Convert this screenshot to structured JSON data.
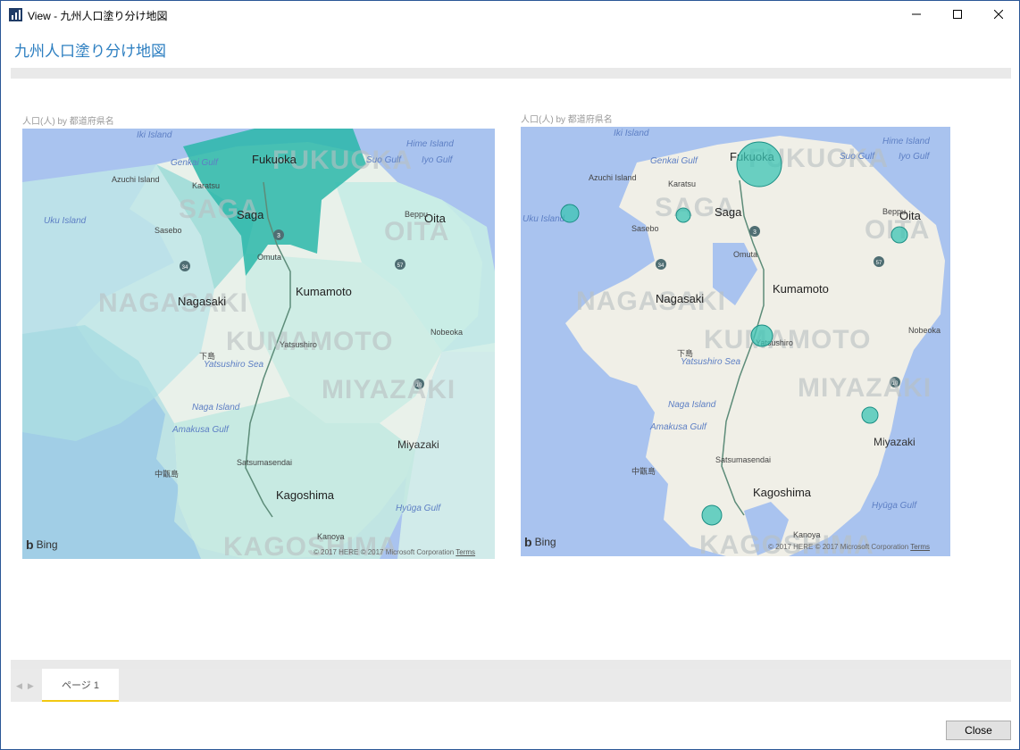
{
  "window": {
    "title": "View - 九州人口塗り分け地図",
    "minimize_icon": "minimize-icon",
    "maximize_icon": "maximize-icon",
    "close_icon": "close-icon"
  },
  "report": {
    "title": "九州人口塗り分け地図"
  },
  "visuals": [
    {
      "title": "人口(人) by 都道府県名",
      "type": "filled-map",
      "attribution": "© 2017 HERE © 2017 Microsoft Corporation",
      "terms_label": "Terms",
      "logo_text": "Bing"
    },
    {
      "title": "人口(人) by 都道府県名",
      "type": "bubble-map",
      "attribution": "© 2017 HERE © 2017 Microsoft Corporation",
      "terms_label": "Terms",
      "logo_text": "Bing"
    }
  ],
  "map_labels": {
    "regions": [
      "FUKUOKA",
      "SAGA",
      "OITA",
      "NAGASAKI",
      "KUMAMOTO",
      "MIYAZAKI",
      "KAGOSHIMA"
    ],
    "cities": [
      "Fukuoka",
      "Saga",
      "Oita",
      "Nagasaki",
      "Kumamoto",
      "Miyazaki",
      "Kagoshima"
    ],
    "towns": [
      "Karatsu",
      "Sasebo",
      "Beppu",
      "Omuta",
      "Yatsushiro",
      "Nobeoka",
      "Satsumasendai",
      "Kanoya",
      "Iki Island",
      "Azuchi Island",
      "Uku Island",
      "下島",
      "中甑島"
    ],
    "waters": [
      "Genkai Gulf",
      "Suo Gulf",
      "Iyo Gulf",
      "Hime Island",
      "Yatsushiro Sea",
      "Naga Island",
      "Amakusa Gulf",
      "Hyūga Gulf"
    ],
    "route_shields": [
      "3",
      "34",
      "57",
      "10"
    ]
  },
  "colors": {
    "accent_title": "#2d7fc1",
    "fill_high": "#2ab7a9",
    "fill_low": "#cfeee9",
    "bubble": "#3cc4b4",
    "water": "#a9c3ef",
    "tab_underline": "#f2c811"
  },
  "pages": {
    "tabs": [
      {
        "label": "ページ 1",
        "active": true
      }
    ]
  },
  "buttons": {
    "close_label": "Close"
  }
}
